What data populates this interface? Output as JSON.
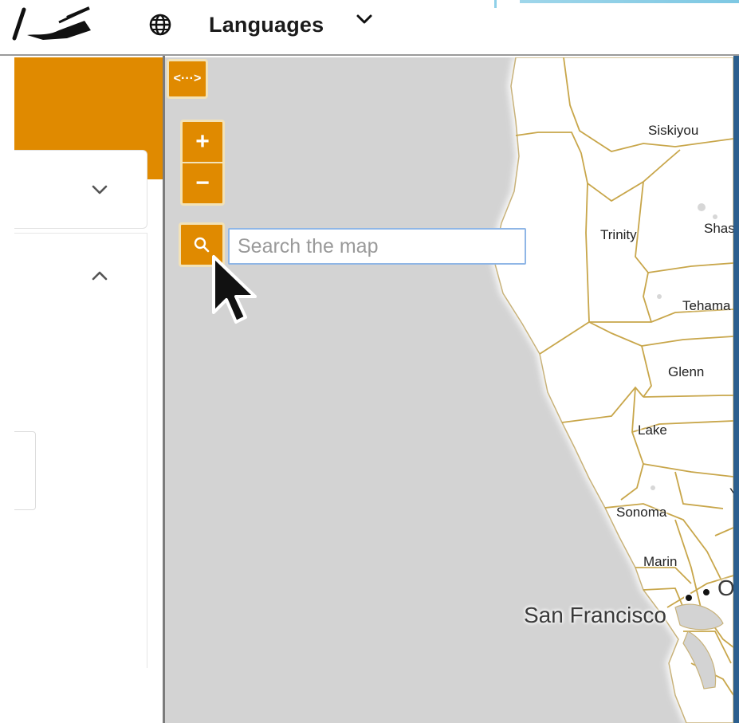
{
  "header": {
    "language_label": "Languages",
    "logo_icon": "hand-writing-icon",
    "globe_icon": "globe-icon",
    "chevron_icon": "chevron-down-icon"
  },
  "left_panel": {
    "card1_chevron": "chevron-down-icon",
    "card2_chevron": "chevron-up-icon"
  },
  "map_controls": {
    "expand_symbol": "<···>",
    "zoom_in_symbol": "+",
    "zoom_out_symbol": "−",
    "search_icon": "search-icon",
    "search_placeholder": "Search the map"
  },
  "map": {
    "counties": [
      "Siskiyou",
      "Trinity",
      "Shas",
      "Tehama",
      "Glenn",
      "Lake",
      "Sonoma",
      "Marin",
      "Y"
    ],
    "cities": [
      "San Francisco",
      "O"
    ]
  },
  "colors": {
    "accent_orange": "#e08a00",
    "map_water": "#d3d3d3",
    "county_border": "#c8a64a"
  }
}
